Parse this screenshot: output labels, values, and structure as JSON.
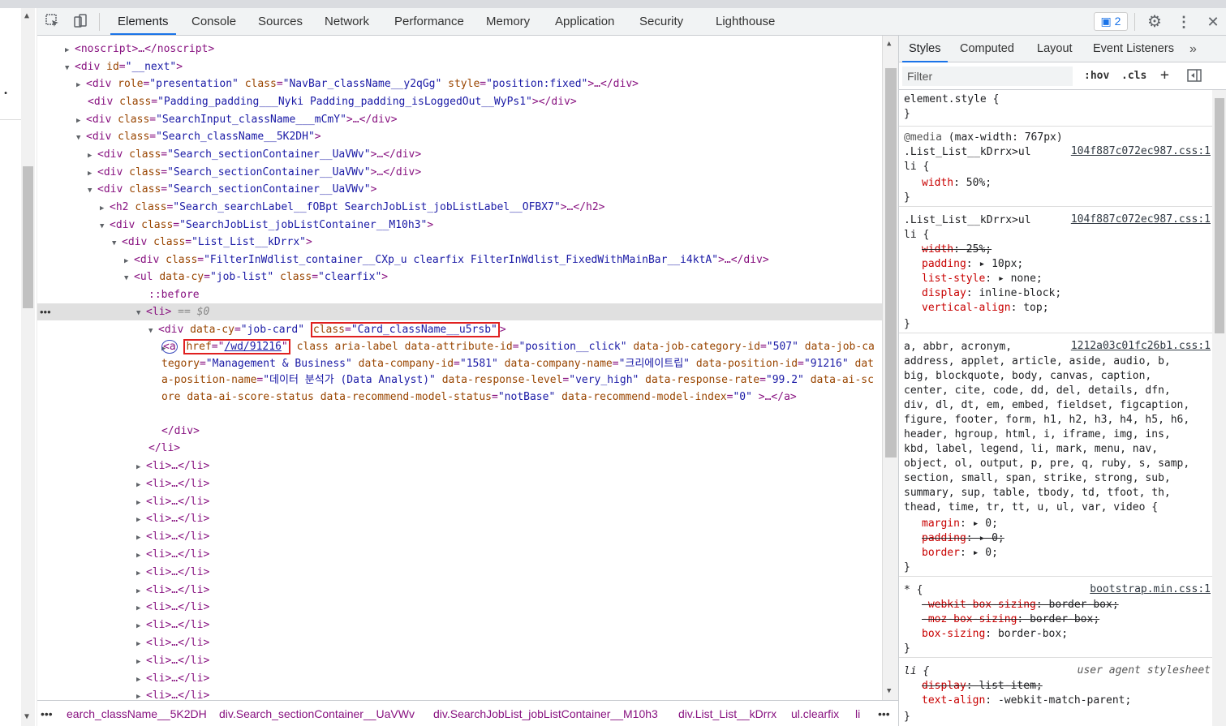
{
  "toolbar": {
    "tabs": [
      "Elements",
      "Console",
      "Sources",
      "Network",
      "Performance",
      "Memory",
      "Application",
      "Security",
      "Lighthouse"
    ],
    "issues_count": "2",
    "icons": [
      "inspect-icon",
      "device-toggle-icon",
      "issues-icon",
      "gear-icon",
      "more-vertical-icon",
      "close-icon"
    ]
  },
  "dom": {
    "l0": "<noscript>…</noscript>",
    "l1_tag": "<div ",
    "l1_an": "id",
    "l1_av": "\"__next\"",
    "l2": {
      "an1": "role",
      "av1": "\"presentation\"",
      "an2": "class",
      "av2": "\"NavBar_className__y2qGg\"",
      "an3": "style",
      "av3": "\"position:fixed\"",
      "tail": ">…</div>"
    },
    "l3": {
      "an": "class",
      "av": "\"Padding_padding___Nyki Padding_padding_isLoggedOut__WyPs1\"",
      "tail": "></div>"
    },
    "l4": {
      "an": "class",
      "av": "\"SearchInput_className___mCmY\"",
      "tail": ">…</div>"
    },
    "l5": {
      "an": "class",
      "av": "\"Search_className__5K2DH\"",
      "tail": ">"
    },
    "l6": {
      "an": "class",
      "av": "\"Search_sectionContainer__UaVWv\"",
      "tail": ">…</div>"
    },
    "l7": {
      "an": "class",
      "av": "\"Search_sectionContainer__UaVWv\"",
      "tail": ">…</div>"
    },
    "l8": {
      "an": "class",
      "av": "\"Search_sectionContainer__UaVWv\"",
      "tail": ">"
    },
    "l9": {
      "an": "class",
      "av": "\"Search_searchLabel__fOBpt SearchJobList_jobListLabel__OFBX7\"",
      "tail": ">…</h2>"
    },
    "l10": {
      "an": "class",
      "av": "\"SearchJobList_jobListContainer__M10h3\"",
      "tail": ">"
    },
    "l11": {
      "an": "class",
      "av": "\"List_List__kDrrx\"",
      "tail": ">"
    },
    "l12": {
      "an": "class",
      "av": "\"FilterInWdlist_container__CXp_u clearfix FilterInWdlist_FixedWithMainBar__i4ktA\"",
      "tail": ">…</div>"
    },
    "l13": {
      "an1": "data-cy",
      "av1": "\"job-list\"",
      "an2": "class",
      "av2": "\"clearfix\"",
      "tail": ">"
    },
    "before": "::before",
    "li_sel": "<li>",
    "li_eq": " == $0",
    "card": {
      "an1": "data-cy",
      "av1": "\"job-card\"",
      "an2": "class",
      "av2": "\"Card_className__u5rsb\"",
      "tail": ">"
    },
    "a": {
      "tag": "<a",
      "href_an": "href",
      "href_av": "/wd/91216",
      "rest": [
        [
          "class",
          ""
        ],
        [
          "aria-label",
          ""
        ],
        [
          "data-attribute-id",
          "\"position__click\""
        ],
        [
          "data-job-category-id",
          "\"507\""
        ],
        [
          "data-job-category",
          "\"Management & Business\""
        ],
        [
          "data-company-id",
          "\"1581\""
        ],
        [
          "data-company-name",
          "\"크리에이트립\""
        ],
        [
          "data-position-id",
          "\"91216\""
        ],
        [
          "data-position-name",
          "\"데이터 분석가 (Data Analyst)\""
        ],
        [
          "data-response-level",
          "\"very_high\""
        ],
        [
          "data-response-rate",
          "\"99.2\""
        ],
        [
          "data-ai-score",
          ""
        ],
        [
          "data-ai-score-status",
          ""
        ],
        [
          "data-recommend-model-status",
          "\"notBase\""
        ],
        [
          "data-recommend-model-index",
          "\"0\""
        ]
      ],
      "tail": ">…</a>"
    },
    "div_close": "</div>",
    "li_close": "</li>",
    "collapsed_li": "<li>…</li>"
  },
  "crumbs": [
    "earch_className__5K2DH",
    "div.Search_sectionContainer__UaVWv",
    "div.SearchJobList_jobListContainer__M10h3",
    "div.List_List__kDrrx",
    "ul.clearfix",
    "li"
  ],
  "styles": {
    "tabs": [
      "Styles",
      "Computed",
      "Layout",
      "Event Listeners"
    ],
    "filter_placeholder": "Filter",
    "hov": ":hov",
    "cls": ".cls",
    "element_style": "element.style {",
    "media": "@media",
    "media_q": "(max-width: 767px)",
    "sel1": ".List_List__kDrrx>ul",
    "sel1b": "li {",
    "src1": "104f887c072ec987.css:1",
    "r1_prop": "width",
    "r1_val": "50%;",
    "sel2": ".List_List__kDrrx>ul",
    "src2": "104f887c072ec987.css:1",
    "r2": [
      [
        "width",
        "25%;",
        true
      ],
      [
        "padding",
        "10px;",
        false
      ],
      [
        "list-style",
        "none;",
        false
      ],
      [
        "display",
        "inline-block;",
        false
      ],
      [
        "vertical-align",
        "top;",
        false
      ]
    ],
    "src3": "1212a03c01fc26b1.css:1",
    "reset_lines": [
      "a, abbr, acronym,",
      "address, applet, article, aside, audio, b,",
      "big, blockquote, body, canvas, caption,",
      "center, cite, code, dd, del, details, dfn,",
      "div, dl, dt, em, embed, fieldset, figcaption,",
      "figure, footer, form, h1, h2, h3, h4, h5, h6,",
      "header, hgroup, html, i, iframe, img, ins,",
      "kbd, label, legend, li, mark, menu, nav,",
      "object, ol, output, p, pre, q, ruby, s, samp,",
      "section, small, span, strike, strong, sub,",
      "summary, sup, table, tbody, td, tfoot, th,",
      "thead, time, tr, tt, u, ul, var, video {"
    ],
    "r3": [
      [
        "margin",
        "0;",
        false
      ],
      [
        "padding",
        "0;",
        true
      ],
      [
        "border",
        "0;",
        false
      ]
    ],
    "src4": "bootstrap.min.css:1",
    "r4": [
      [
        "-webkit-box-sizing",
        "border-box;",
        true
      ],
      [
        "-moz-box-sizing",
        "border-box;",
        true
      ],
      [
        "box-sizing",
        "border-box;",
        false
      ]
    ],
    "ua_label": "user agent stylesheet",
    "r5": [
      [
        "display",
        "list-item;",
        true
      ],
      [
        "text-align",
        "-webkit-match-parent;",
        false
      ]
    ]
  }
}
